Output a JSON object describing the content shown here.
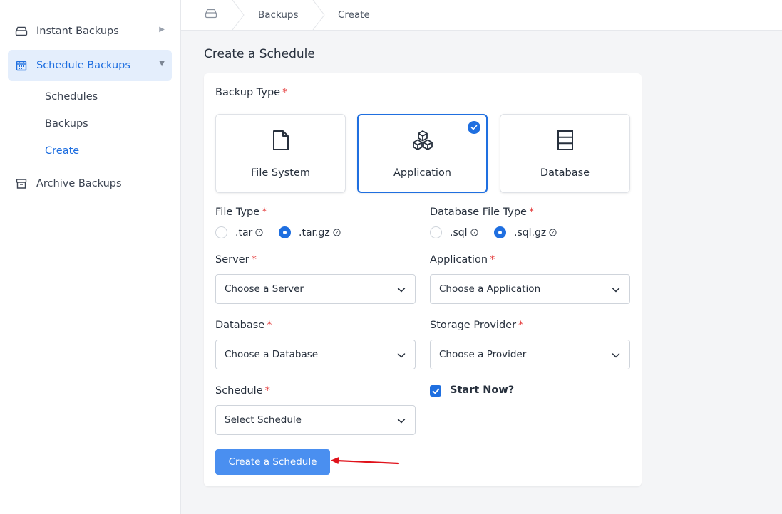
{
  "sidebar": {
    "items": [
      {
        "label": "Instant Backups",
        "icon": "drive-icon"
      },
      {
        "label": "Schedule Backups",
        "icon": "calendar-icon"
      },
      {
        "label": "Archive Backups",
        "icon": "archive-icon"
      }
    ],
    "sub_items": [
      {
        "label": "Schedules"
      },
      {
        "label": "Backups"
      },
      {
        "label": "Create"
      }
    ]
  },
  "breadcrumb": {
    "home_icon": "drive-icon",
    "items": [
      "Backups",
      "Create"
    ]
  },
  "page": {
    "title": "Create a Schedule"
  },
  "form": {
    "backup_type_label": "Backup Type",
    "backup_types": [
      {
        "label": "File System",
        "icon": "file-icon",
        "selected": false
      },
      {
        "label": "Application",
        "icon": "cubes-icon",
        "selected": true
      },
      {
        "label": "Database",
        "icon": "database-icon",
        "selected": false
      }
    ],
    "file_type": {
      "label": "File Type",
      "options": [
        ".tar",
        ".tar.gz"
      ],
      "selected": ".tar.gz"
    },
    "db_file_type": {
      "label": "Database File Type",
      "options": [
        ".sql",
        ".sql.gz"
      ],
      "selected": ".sql.gz"
    },
    "server": {
      "label": "Server",
      "value": "Choose a Server"
    },
    "application": {
      "label": "Application",
      "value": "Choose a Application"
    },
    "database": {
      "label": "Database",
      "value": "Choose a Database"
    },
    "storage": {
      "label": "Storage Provider",
      "value": "Choose a Provider"
    },
    "schedule": {
      "label": "Schedule",
      "value": "Select Schedule"
    },
    "start_now": {
      "label": "Start Now?",
      "checked": true
    },
    "submit_label": "Create a Schedule",
    "required_mark": "*"
  },
  "colors": {
    "accent": "#1f6fe0",
    "button": "#4a8ff0",
    "required": "#e53e3e",
    "annotation_arrow": "#e0121b"
  }
}
